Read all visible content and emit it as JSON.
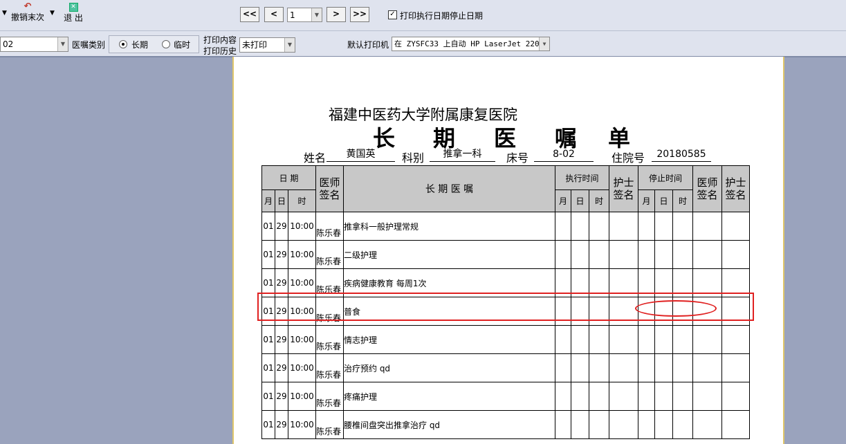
{
  "toolbar": {
    "undo_label": "撤销末次",
    "exit_label": "退 出",
    "first_label": "<<",
    "prev_label": "<",
    "page_value": "1",
    "next_label": ">",
    "last_label": ">>",
    "print_stop_date_label": "打印执行日期停止日期",
    "print_stop_date_checked": true
  },
  "filters": {
    "bed_value": "02",
    "order_type_label": "医嘱类别",
    "long_term_label": "长期",
    "temporary_label": "临时",
    "selected_type": "长期",
    "print_content_label": "打印内容",
    "print_history_label": "打印历史",
    "print_status_value": "未打印",
    "default_printer_label": "默认打印机",
    "printer_value": "在 ZYSFC33 上自动 HP LaserJet 220"
  },
  "document": {
    "hospital": "福建中医药大学附属康复医院",
    "title_chars": [
      "长",
      "期",
      "医",
      "嘱",
      "单"
    ],
    "name_label": "姓名",
    "name_value": "黄国英",
    "dept_label": "科别",
    "dept_value": "推拿一科",
    "bed_label": "床号",
    "bed_value": "8-02",
    "admission_label": "住院号",
    "admission_value": "20180585"
  },
  "table": {
    "date_header": "日 期",
    "doctor_sig_header": "医师签名",
    "order_header": "长 期 医 嘱",
    "exec_time_header": "执行时间",
    "nurse_sig_header": "护士签名",
    "stop_time_header": "停止时间",
    "stop_doctor_sig_header": "医师签名",
    "stop_nurse_sig_header": "护士签名",
    "month_header": "月",
    "day_header": "日",
    "time_header": "时",
    "rows": [
      {
        "month": "01",
        "day": "29",
        "time": "10:00",
        "doctor": "陈乐春",
        "order": "推拿科一般护理常规"
      },
      {
        "month": "01",
        "day": "29",
        "time": "10:00",
        "doctor": "陈乐春",
        "order": "二级护理"
      },
      {
        "month": "01",
        "day": "29",
        "time": "10:00",
        "doctor": "陈乐春",
        "order": "疾病健康教育 每周1次"
      },
      {
        "month": "01",
        "day": "29",
        "time": "10:00",
        "doctor": "陈乐春",
        "order": "普食"
      },
      {
        "month": "01",
        "day": "29",
        "time": "10:00",
        "doctor": "陈乐春",
        "order": "情志护理"
      },
      {
        "month": "01",
        "day": "29",
        "time": "10:00",
        "doctor": "陈乐春",
        "order": "治疗预约 qd"
      },
      {
        "month": "01",
        "day": "29",
        "time": "10:00",
        "doctor": "陈乐春",
        "order": "疼痛护理"
      },
      {
        "month": "01",
        "day": "29",
        "time": "10:00",
        "doctor": "陈乐春",
        "order": "腰椎间盘突出推拿治疗 qd"
      }
    ]
  },
  "colors": {
    "annotation": "#e02020",
    "toolbar_bg": "#dfe3ee",
    "workspace_bg": "#9aa3bd",
    "header_bg": "#c8c8c8"
  }
}
